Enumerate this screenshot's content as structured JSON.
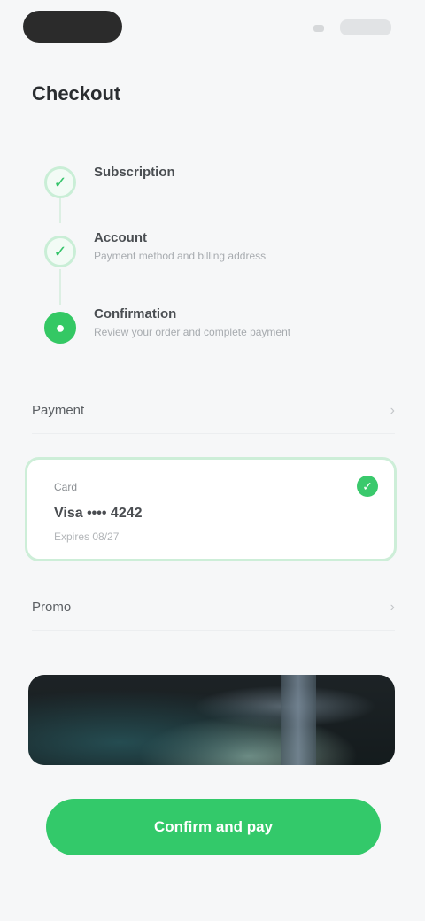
{
  "page": {
    "title": "Checkout"
  },
  "steps": [
    {
      "title": "Subscription",
      "description": "",
      "icon": "check-icon",
      "active": false
    },
    {
      "title": "Account",
      "description": "Payment method and billing address",
      "icon": "check-icon",
      "active": false
    },
    {
      "title": "Confirmation",
      "description": "Review your order and complete payment",
      "icon": "circle-icon",
      "active": true
    }
  ],
  "rows": {
    "payment": {
      "label": "Payment"
    },
    "promo": {
      "label": "Promo"
    }
  },
  "selected_card": {
    "small": "Card",
    "main": "Visa •••• 4242",
    "sub": "Expires 08/27"
  },
  "button": {
    "label": "Confirm and pay"
  },
  "colors": {
    "accent": "#33c96a",
    "accent_soft": "#cdeed8",
    "text": "#2a2d30",
    "muted": "#a7abaf"
  }
}
